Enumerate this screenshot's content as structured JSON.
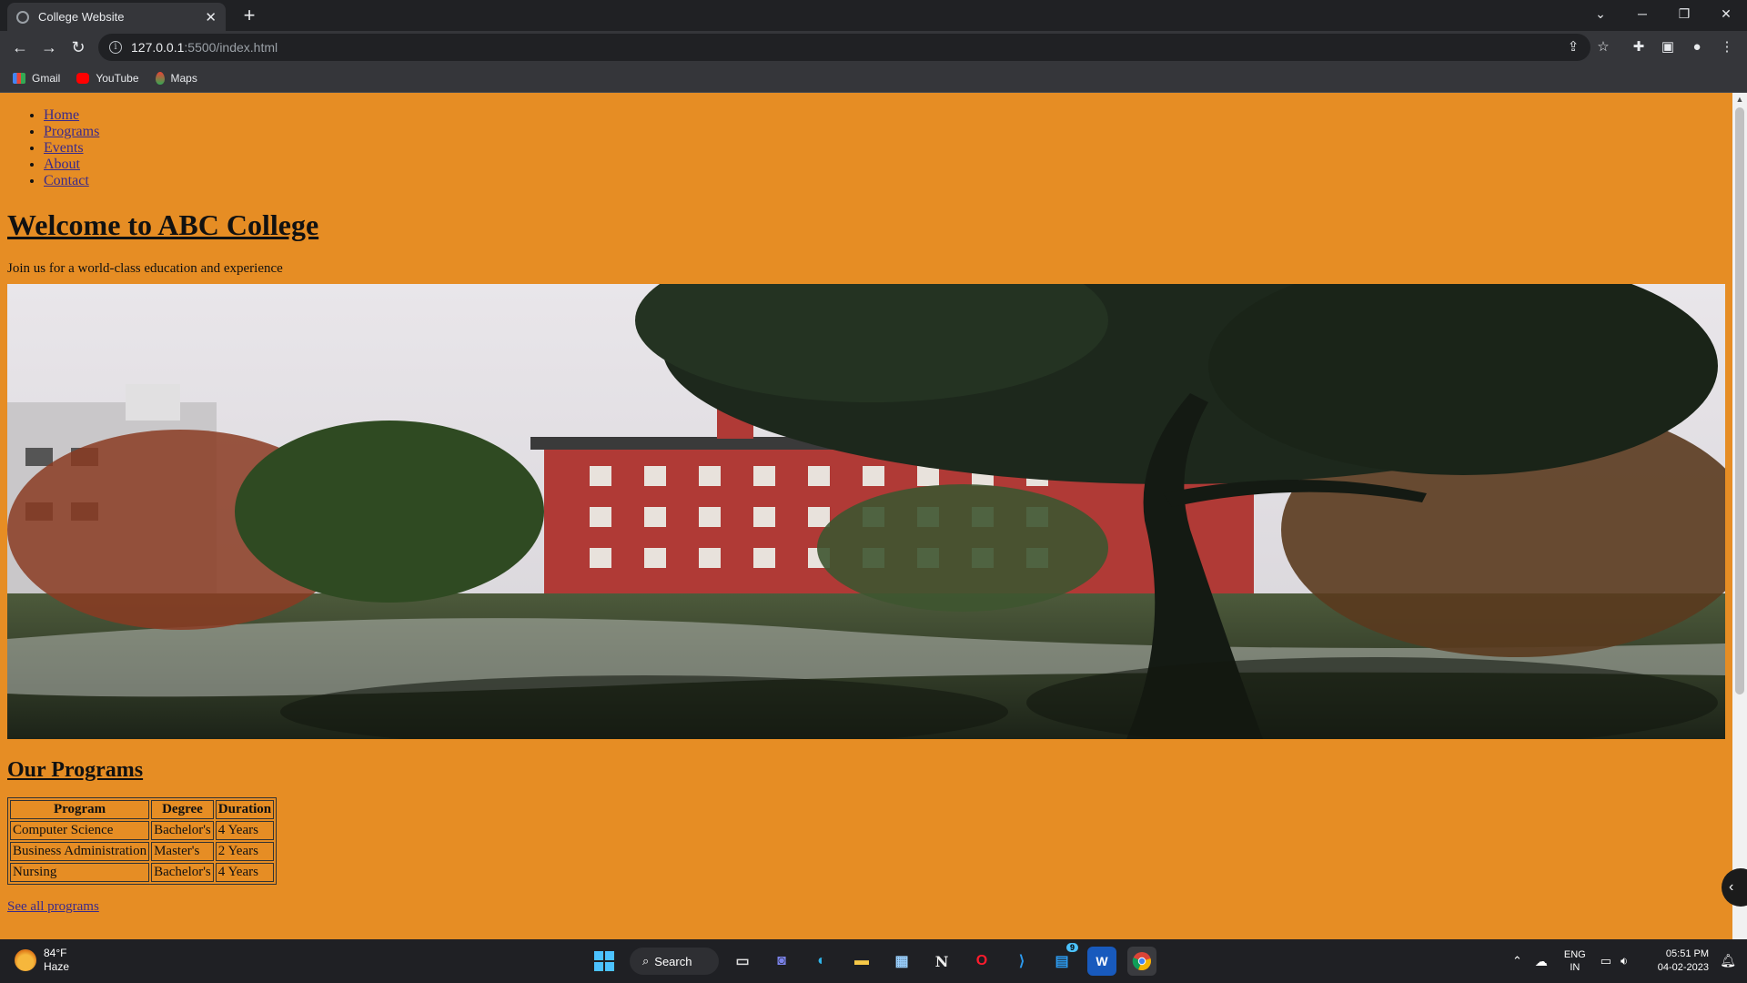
{
  "browser": {
    "tab_title": "College Website",
    "new_tab_label": "+",
    "url_host": "127.0.0.1",
    "url_path": ":5500/index.html",
    "bookmarks": [
      "Gmail",
      "YouTube",
      "Maps"
    ]
  },
  "page": {
    "nav": [
      "Home",
      "Programs",
      "Events",
      "About",
      "Contact"
    ],
    "hero": {
      "title": "Welcome to ABC College",
      "subtitle": "Join us for a world-class education and experience"
    },
    "programs": {
      "title": "Our Programs",
      "headers": [
        "Program",
        "Degree",
        "Duration"
      ],
      "rows": [
        [
          "Computer Science",
          "Bachelor's",
          "4 Years"
        ],
        [
          "Business Administration",
          "Master's",
          "2 Years"
        ],
        [
          "Nursing",
          "Bachelor's",
          "4 Years"
        ]
      ],
      "see_all": "See all programs"
    },
    "background_color": "#e68d24"
  },
  "taskbar": {
    "weather_temp": "84°F",
    "weather_desc": "Haze",
    "search_label": "Search",
    "lang_top": "ENG",
    "lang_bottom": "IN",
    "time": "05:51 PM",
    "date": "04-02-2023",
    "badge": "9"
  }
}
